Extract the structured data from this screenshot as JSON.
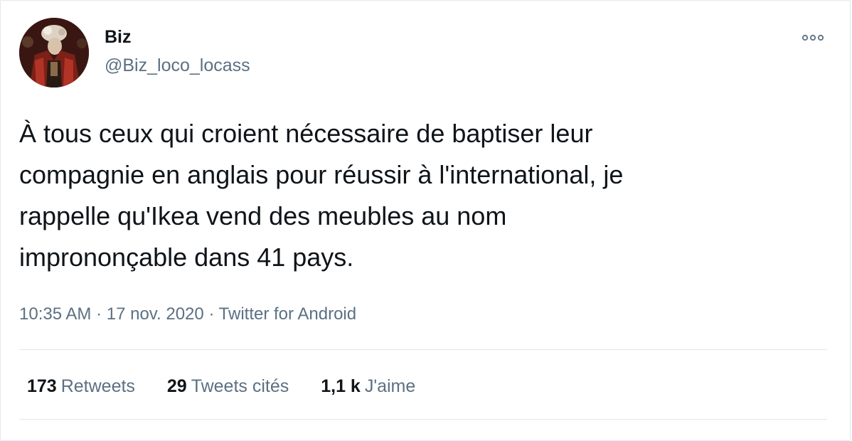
{
  "author": {
    "name": "Biz",
    "handle": "@Biz_loco_locass",
    "avatar_icon": "user-avatar"
  },
  "menu_icon": "more-options-icon",
  "tweet": {
    "text": "À tous ceux qui croient nécessaire de baptiser leur\ncompagnie en anglais pour réussir à l'international, je\nrappelle qu'Ikea vend des meubles au nom\nimprononçable dans 41 pays.",
    "time": "10:35 AM",
    "date": "17 nov. 2020",
    "source": "Twitter for Android",
    "separator": "·"
  },
  "stats": [
    {
      "count": "173",
      "label": "Retweets"
    },
    {
      "count": "29",
      "label": "Tweets cités"
    },
    {
      "count": "1,1 k",
      "label": "J'aime"
    }
  ],
  "colors": {
    "text_primary": "#0f1419",
    "text_secondary": "#5b7083",
    "border": "#e3e8ec"
  }
}
